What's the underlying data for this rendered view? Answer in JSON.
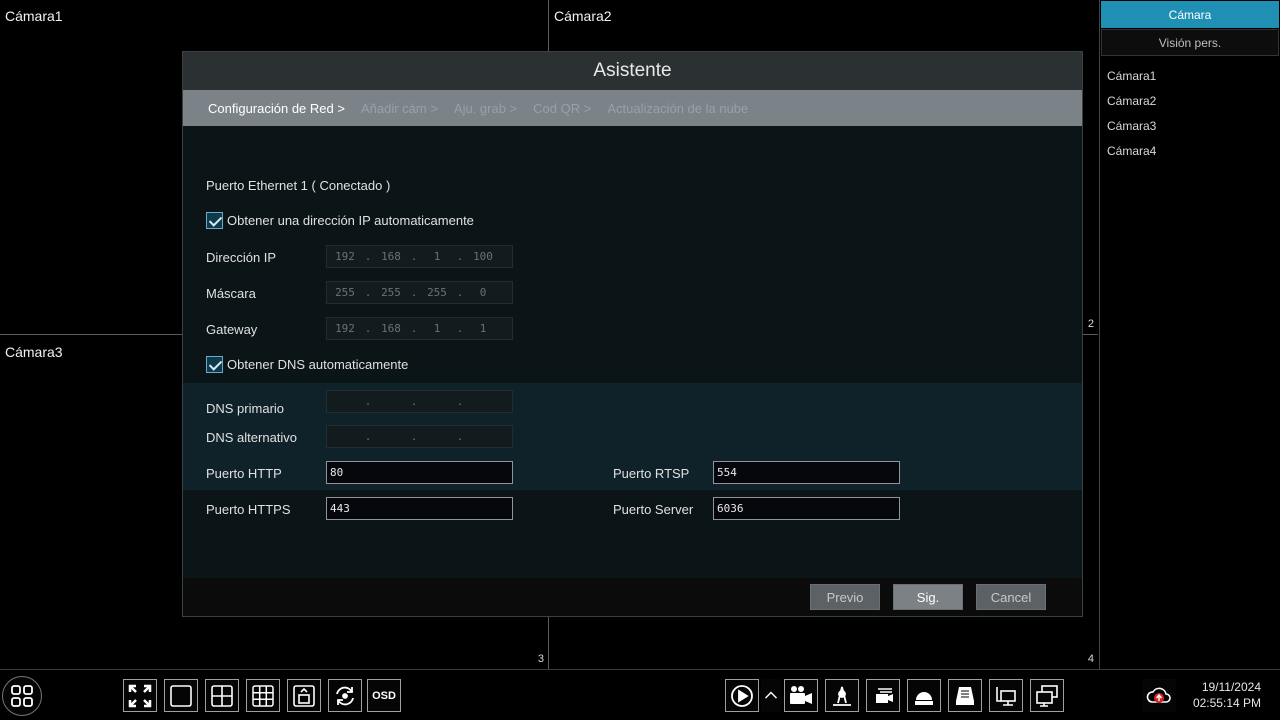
{
  "cameras": {
    "cam1": "Cámara1",
    "cam2": "Cámara2",
    "cam3": "Cámara3",
    "num2": "2",
    "num3": "3",
    "num4": "4"
  },
  "right_panel": {
    "tab_camera": "Cámara",
    "tab_custom_view": "Visión pers.",
    "items": [
      "Cámara1",
      "Cámara2",
      "Cámara3",
      "Cámara4"
    ]
  },
  "dialog": {
    "title": "Asistente",
    "steps": [
      "Configuración de Red >",
      "Añadir cám >",
      "Aju. grab >",
      "Cod QR >",
      "Actualización de la nube"
    ],
    "ethernet_status": "Puerto Ethernet 1 ( Conectado )",
    "auto_ip_label": "Obtener una dirección IP automaticamente",
    "ip_label": "Dirección IP",
    "ip_value": [
      "192",
      "168",
      "1",
      "100"
    ],
    "mask_label": "Máscara",
    "mask_value": [
      "255",
      "255",
      "255",
      "0"
    ],
    "gateway_label": "Gateway",
    "gateway_value": [
      "192",
      "168",
      "1",
      "1"
    ],
    "auto_dns_label": "Obtener DNS automaticamente",
    "dns_primary_label": "DNS primario",
    "dns_alt_label": "DNS alternativo",
    "http_port_label": "Puerto HTTP",
    "http_port_value": "80",
    "https_port_label": "Puerto HTTPS",
    "https_port_value": "443",
    "rtsp_port_label": "Puerto RTSP",
    "rtsp_port_value": "554",
    "server_port_label": "Puerto Server",
    "server_port_value": "6036",
    "btn_prev": "Previo",
    "btn_next": "Sig.",
    "btn_cancel": "Cancel"
  },
  "taskbar": {
    "osd_label": "OSD",
    "date": "19/11/2024",
    "time": "02:55:14 PM"
  }
}
